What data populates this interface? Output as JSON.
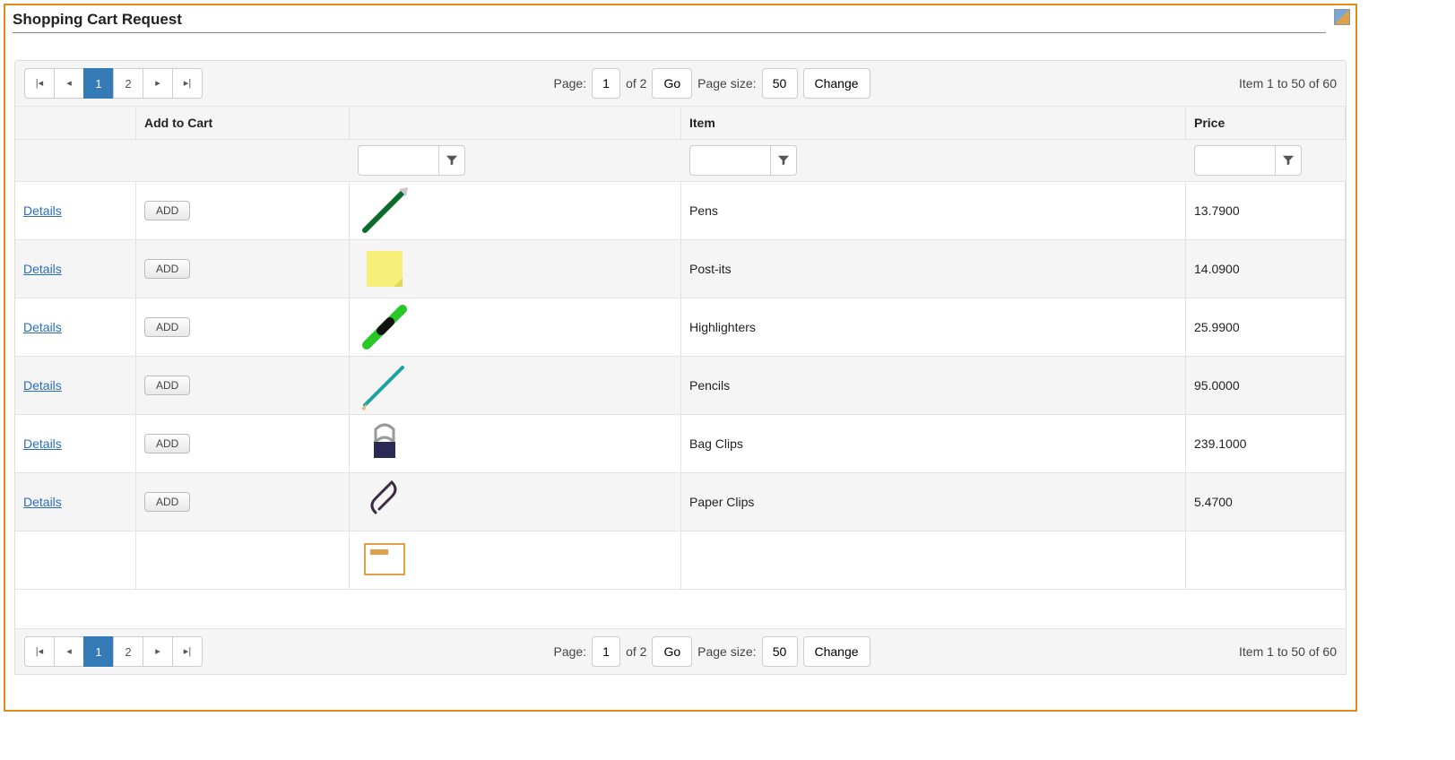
{
  "title": "Shopping Cart Request",
  "pager": {
    "page_label": "Page:",
    "of_label": "of 2",
    "go_label": "Go",
    "pagesize_label": "Page size:",
    "change_label": "Change",
    "range_text": "Item 1 to 50 of 60",
    "current_page": "1",
    "page2": "2",
    "page_size": "50"
  },
  "columns": {
    "add_to_cart": "Add to Cart",
    "item": "Item",
    "price": "Price"
  },
  "links": {
    "details": "Details"
  },
  "buttons": {
    "add": "ADD"
  },
  "rows": [
    {
      "item": "Pens",
      "price": "13.7900",
      "icon": "pen"
    },
    {
      "item": "Post-its",
      "price": "14.0900",
      "icon": "postit"
    },
    {
      "item": "Highlighters",
      "price": "25.9900",
      "icon": "highlighter"
    },
    {
      "item": "Pencils",
      "price": "95.0000",
      "icon": "pencil"
    },
    {
      "item": "Bag Clips",
      "price": "239.1000",
      "icon": "bagclip"
    },
    {
      "item": "Paper Clips",
      "price": "5.4700",
      "icon": "paperclip"
    }
  ]
}
